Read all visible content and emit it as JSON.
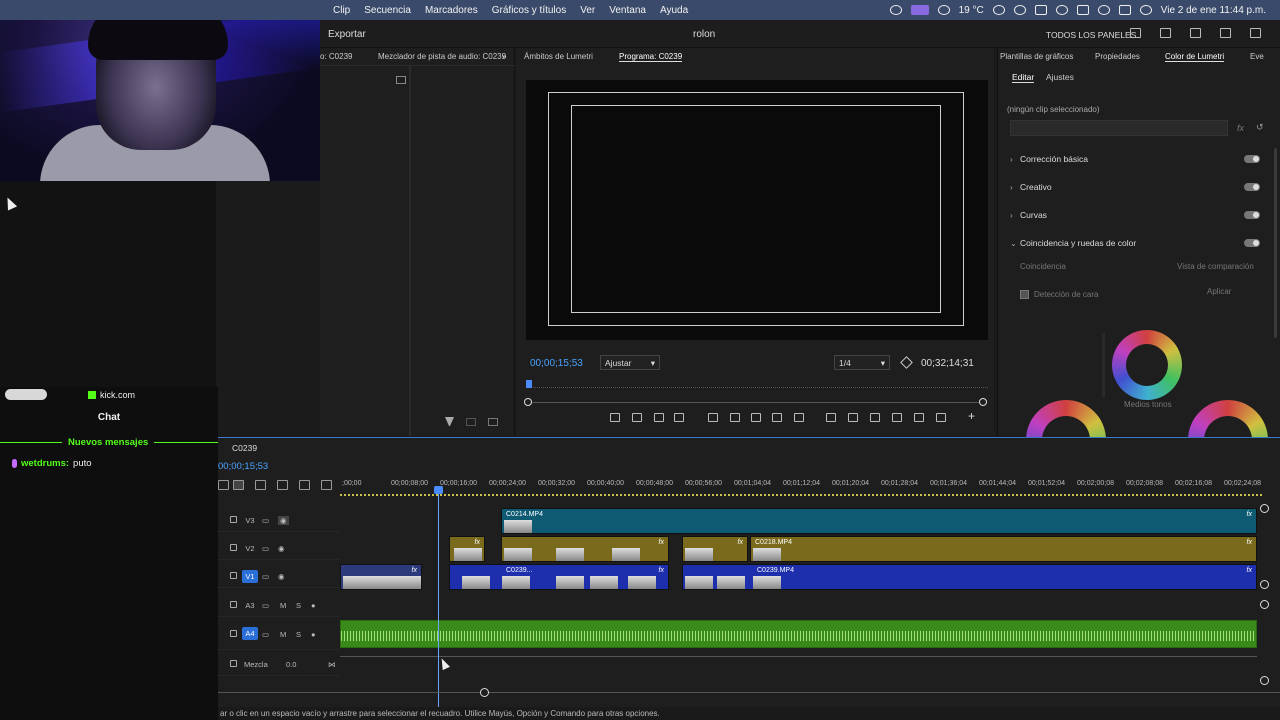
{
  "menubar": {
    "items": [
      "Clip",
      "Secuencia",
      "Marcadores",
      "Gráficos y títulos",
      "Ver",
      "Ventana",
      "Ayuda"
    ],
    "weather": "19 °C",
    "datetime": "Vie 2 de ene  11:44 p.m."
  },
  "app": {
    "export_label": "Exportar",
    "project_name": "rolon",
    "all_panels_label": "TODOS LOS PANELES"
  },
  "chat": {
    "site": "kick.com",
    "title": "Chat",
    "new_messages": "Nuevos mensajes",
    "messages": [
      {
        "user": "wetdrums:",
        "text": "puto"
      }
    ]
  },
  "source_panel": {
    "tab1": "o: C0239",
    "tab2": "Mezclador de pista de audio: C0239"
  },
  "program_panel": {
    "tab_scopes": "Ámbitos de Lumetri",
    "tab_program": "Programa: C0239",
    "timecode": "00;00;15;53",
    "fit_label": "Ajustar",
    "resolution": "1/4",
    "duration": "00;32;14;31"
  },
  "lumetri": {
    "tabs": [
      "Plantillas de gráficos",
      "Propiedades",
      "Color de Lumetri",
      "Eve"
    ],
    "subtabs": [
      "Editar",
      "Ajustes"
    ],
    "no_clip": "(ningún clip seleccionado)",
    "sections": [
      "Corrección básica",
      "Creativo",
      "Curvas",
      "Coincidencia y ruedas de color"
    ],
    "match_label": "Coincidencia",
    "compare_label": "Vista de comparación",
    "face_label": "Detección de cara",
    "apply_label": "Aplicar",
    "midtones_label": "Medios tonos"
  },
  "timeline": {
    "sequence": "C0239",
    "timecode": "00;00;15;53",
    "ticks": [
      ";00;00",
      "00;00;08;00",
      "00;00;16;00",
      "00;00;24;00",
      "00;00;32;00",
      "00;00;40;00",
      "00;00;48;00",
      "00;00;56;00",
      "00;01;04;04",
      "00;01;12;04",
      "00;01;20;04",
      "00;01;28;04",
      "00;01;36;04",
      "00;01;44;04",
      "00;01;52;04",
      "00;02;00;08",
      "00;02;08;08",
      "00;02;16;08",
      "00;02;24;08"
    ],
    "tracks": [
      "V3",
      "V2",
      "V1",
      "A3",
      "A4"
    ],
    "mix_label": "Mezcla",
    "mix_value": "0.0",
    "clips": {
      "v3": "C0214.MP4",
      "v2": "C0218.MP4",
      "v1a": "C0239...",
      "v1b": "C0239.MP4"
    },
    "fx": "fx",
    "m_label": "M",
    "s_label": "S"
  },
  "status_text": "ar o clic en un espacio vacío y arrastre para seleccionar el recuadro. Utilice Mayús, Opción y Comando para otras opciones."
}
